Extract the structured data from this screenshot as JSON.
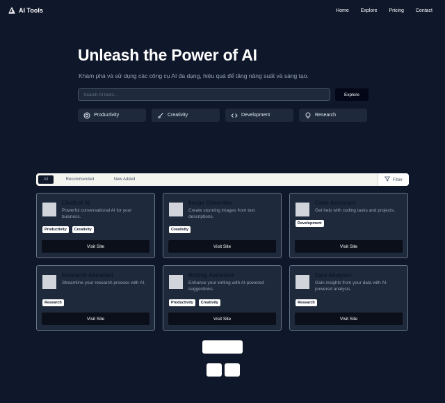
{
  "brand": {
    "name": "AI Tools",
    "logo_icon": "triangle-logo-icon"
  },
  "nav": {
    "links": [
      "Home",
      "Explore",
      "Pricing",
      "Contact"
    ]
  },
  "hero": {
    "title": "Unleash the Power of AI",
    "subtitle": "Khám phá và sử dụng các công cụ AI đa dạng, hiệu quả để tăng năng suất và sáng tạo."
  },
  "search": {
    "placeholder": "Search AI tools...",
    "value": "",
    "button": "Explore"
  },
  "categories": [
    {
      "label": "Productivity",
      "icon": "target-icon"
    },
    {
      "label": "Creativity",
      "icon": "brush-icon"
    },
    {
      "label": "Development",
      "icon": "code-icon"
    },
    {
      "label": "Research",
      "icon": "lightbulb-icon"
    }
  ],
  "tabs": {
    "items": [
      "All",
      "Recommended",
      "New Added"
    ],
    "active": "All",
    "filter": "Filter"
  },
  "cards": [
    {
      "title": "Chatbot AI",
      "description": "Powerful conversational AI for your business.",
      "tags": [
        "Productivity",
        "Creativity"
      ],
      "button": "Visit Site"
    },
    {
      "title": "Image Generator",
      "description": "Create stunning images from text descriptions.",
      "tags": [
        "Creativity"
      ],
      "button": "Visit Site"
    },
    {
      "title": "Code Assistant",
      "description": "Get help with coding tasks and projects.",
      "tags": [
        "Development"
      ],
      "button": "Visit Site"
    },
    {
      "title": "Research Assistant",
      "description": "Streamline your research process with AI.",
      "tags": [
        "Research"
      ],
      "button": "Visit Site"
    },
    {
      "title": "Writing Assistant",
      "description": "Enhance your writing with AI-powered suggestions.",
      "tags": [
        "Productivity",
        "Creativity"
      ],
      "button": "Visit Site"
    },
    {
      "title": "Data Analyzer",
      "description": "Gain insights from your data with AI-powered analysis.",
      "tags": [
        "Research"
      ],
      "button": "Visit Site"
    }
  ],
  "colors": {
    "background": "#0f172a",
    "card": "#1e293b",
    "border": "#64748b",
    "muted": "#94a3b8"
  }
}
